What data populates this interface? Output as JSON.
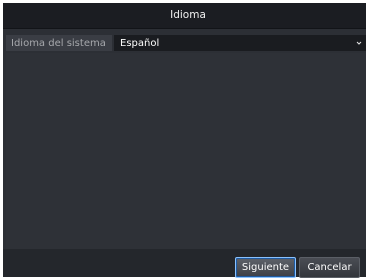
{
  "dialog": {
    "title": "Idioma"
  },
  "setting": {
    "label": "Idioma del sistema",
    "value": "Español",
    "dropdown_icon": "chevron-down-icon"
  },
  "buttons": {
    "next_label": "Siguiente",
    "cancel_label": "Cancelar"
  },
  "colors": {
    "accent": "#8ac2ff",
    "background": "#2c2f35",
    "titlebar": "#1b1d22"
  }
}
